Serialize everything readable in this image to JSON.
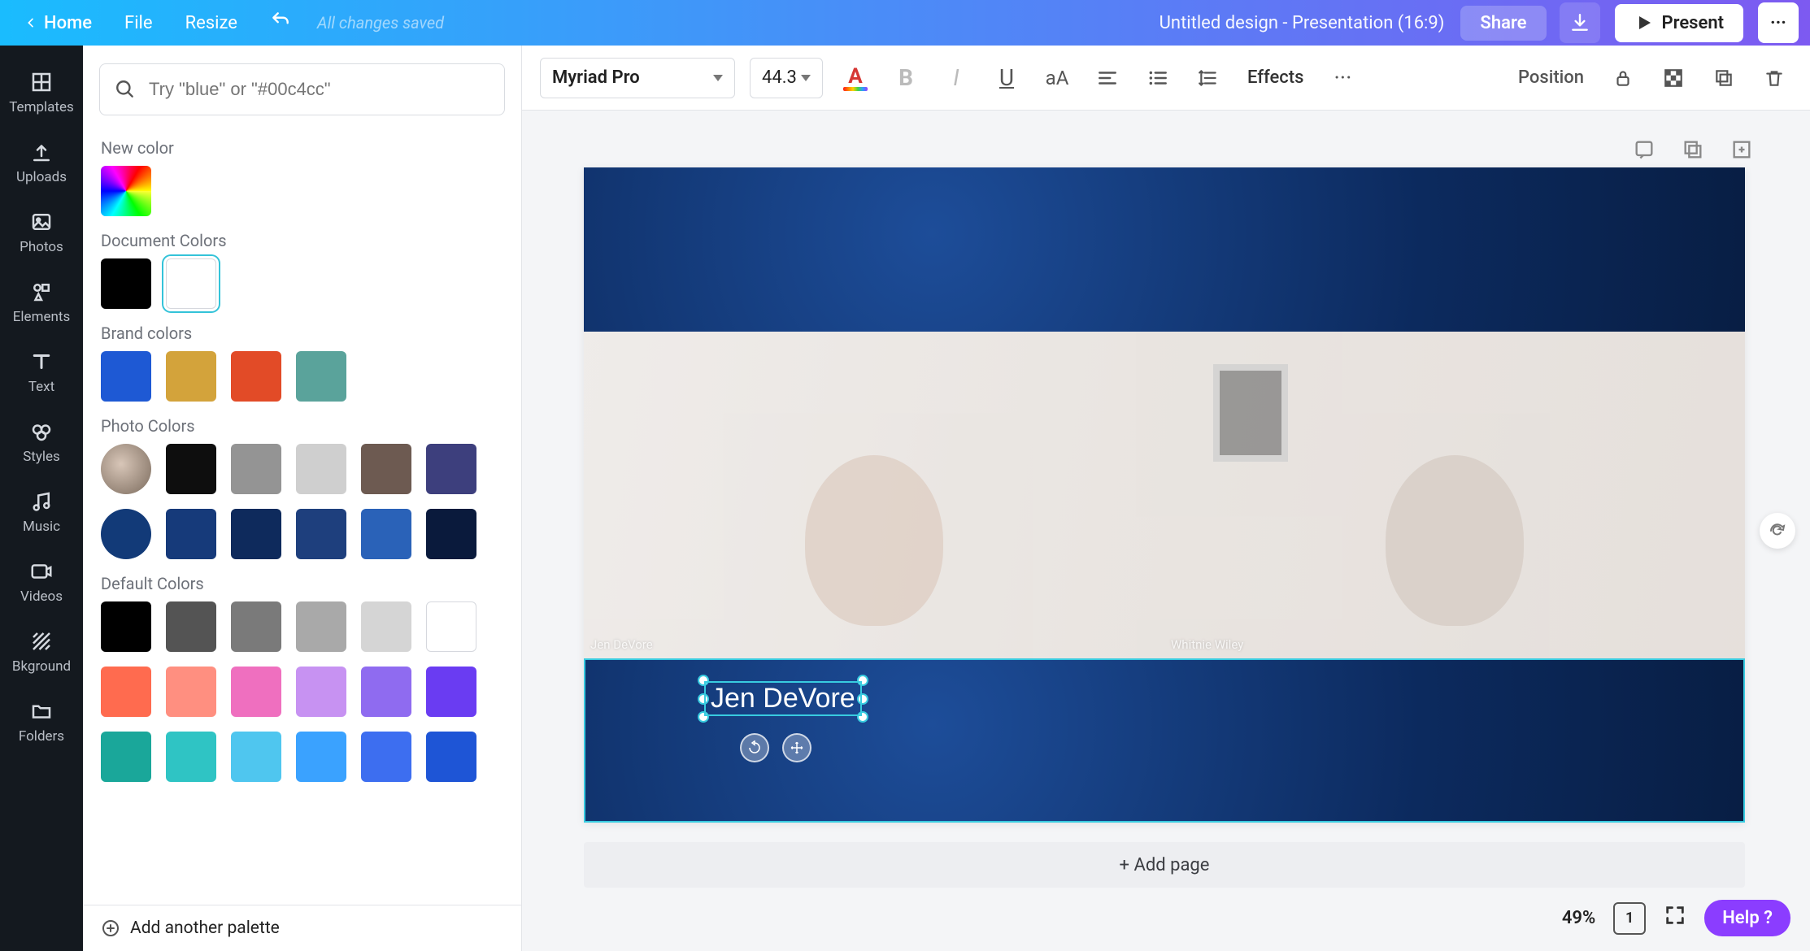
{
  "topbar": {
    "home": "Home",
    "file": "File",
    "resize": "Resize",
    "status": "All changes saved",
    "doctitle": "Untitled design - Presentation (16:9)",
    "share": "Share",
    "present": "Present"
  },
  "rail": [
    {
      "id": "templates",
      "label": "Templates"
    },
    {
      "id": "uploads",
      "label": "Uploads"
    },
    {
      "id": "photos",
      "label": "Photos"
    },
    {
      "id": "elements",
      "label": "Elements"
    },
    {
      "id": "text",
      "label": "Text"
    },
    {
      "id": "styles",
      "label": "Styles"
    },
    {
      "id": "music",
      "label": "Music"
    },
    {
      "id": "videos",
      "label": "Videos"
    },
    {
      "id": "background",
      "label": "Bkground"
    },
    {
      "id": "folders",
      "label": "Folders"
    }
  ],
  "panel": {
    "search_placeholder": "Try \"blue\" or \"#00c4cc\"",
    "newcolor_label": "New color",
    "doc_label": "Document Colors",
    "doc_colors": [
      "#000000",
      "#ffffff"
    ],
    "brand_label": "Brand colors",
    "brand_colors": [
      "#1e59d4",
      "#d3a33b",
      "#e24b27",
      "#5aa39b"
    ],
    "photo_label": "Photo Colors",
    "photo_row1": [
      "photo",
      "#0e0e0e",
      "#949494",
      "#cfcfcf",
      "#6d5a51",
      "#3d3f7d"
    ],
    "photo_row2": [
      "#123a78",
      "#163a7a",
      "#0e2a5c",
      "#1e3f7d",
      "#2a62b8",
      "#0a1a3c"
    ],
    "default_label": "Default Colors",
    "default_row1": [
      "#000000",
      "#545454",
      "#7a7a7a",
      "#a9a9a9",
      "#d5d5d5",
      "#ffffff"
    ],
    "default_row2": [
      "#ff6b4f",
      "#ff8f80",
      "#ef6fbf",
      "#c792f2",
      "#8f6bf0",
      "#6a3cf2"
    ],
    "default_row3": [
      "#1aa79a",
      "#2fc4c4",
      "#4fc6ef",
      "#3aa2ff",
      "#3d6ef0",
      "#1e55d6"
    ],
    "addpalette": "Add another palette"
  },
  "toolbar": {
    "font": "Myriad Pro",
    "size": "44.3",
    "effects": "Effects",
    "position": "Position"
  },
  "canvas": {
    "person1_label": "Jen DeVore",
    "person2_label": "Whitnie Wiley",
    "textbox": "Jen DeVore",
    "addpage": "+ Add page"
  },
  "status": {
    "zoom": "49%",
    "page": "1",
    "help": "Help  ?"
  }
}
